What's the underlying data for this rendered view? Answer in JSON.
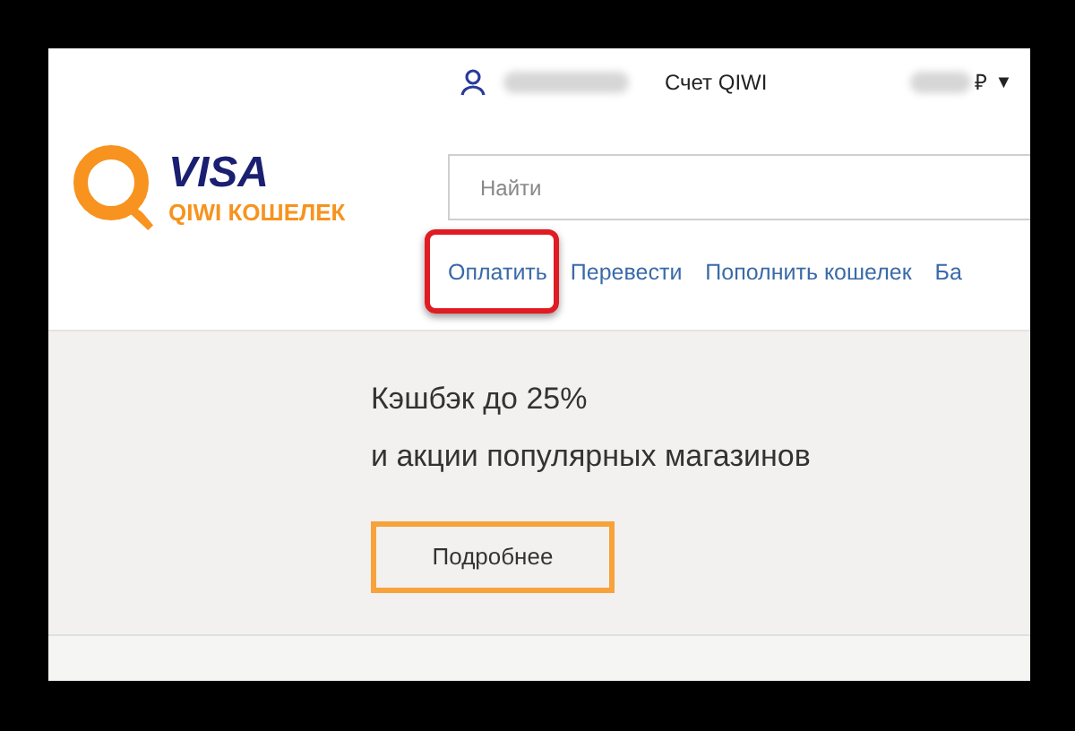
{
  "account_bar": {
    "account_label": "Счет QIWI",
    "currency": "₽",
    "caret": "▼"
  },
  "logo": {
    "brand": "VISA",
    "subtitle": "QIWI КОШЕЛЕК"
  },
  "search": {
    "placeholder": "Найти"
  },
  "nav": [
    {
      "label": "Оплатить",
      "highlighted": true
    },
    {
      "label": "Перевести",
      "highlighted": false
    },
    {
      "label": "Пополнить кошелек",
      "highlighted": false
    },
    {
      "label": "Ба",
      "highlighted": false
    }
  ],
  "promo": {
    "title": "Кэшбэк до 25%",
    "subtitle": "и акции популярных магазинов",
    "button": "Подробнее"
  }
}
